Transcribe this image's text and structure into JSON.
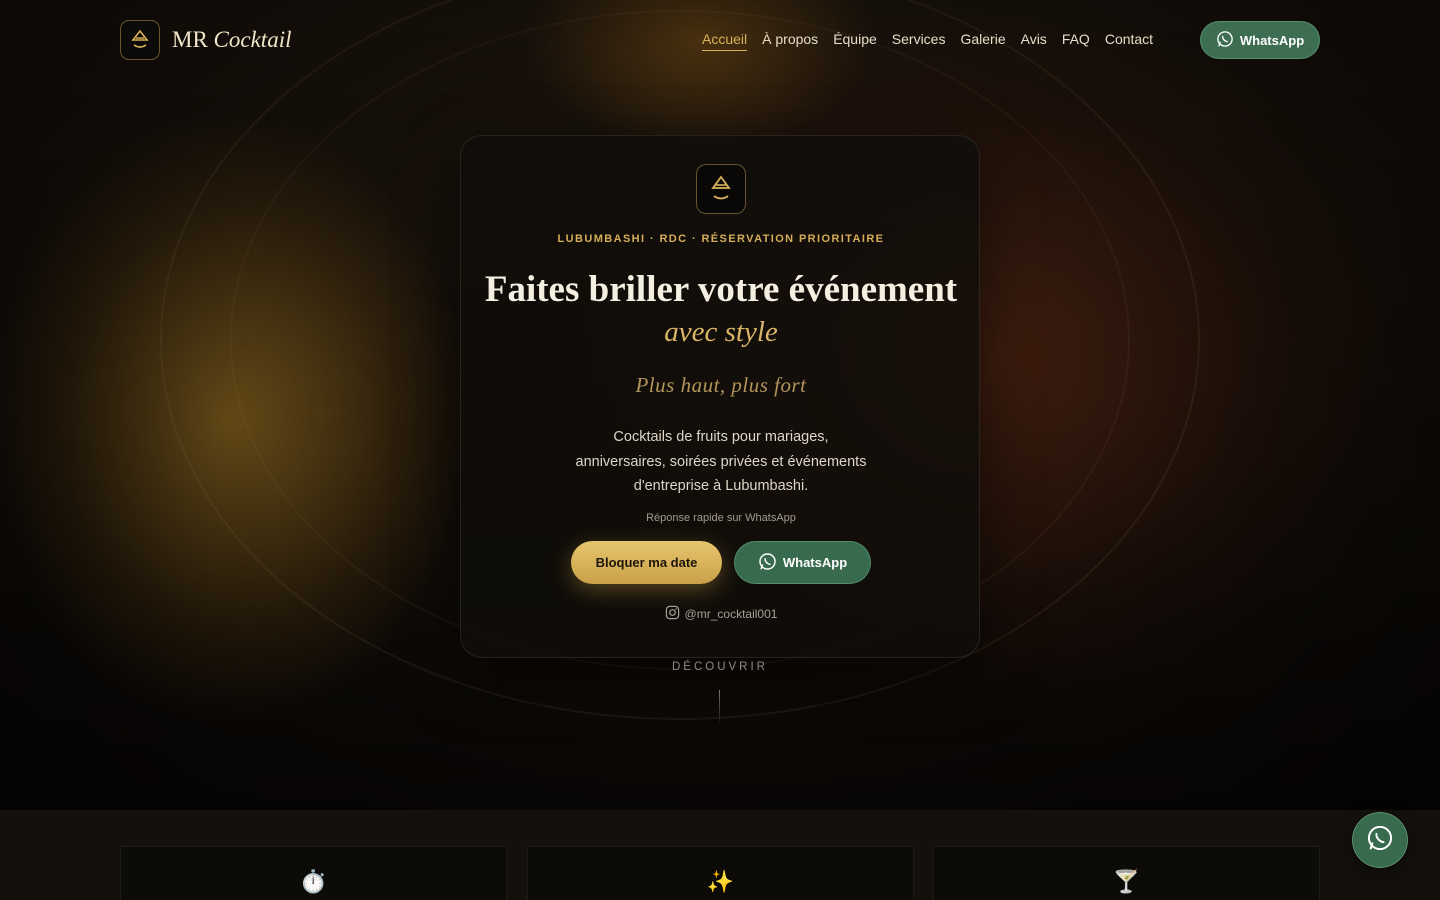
{
  "brand": {
    "name_prefix": "MR",
    "name_italic": "Cocktail"
  },
  "nav": {
    "items": [
      {
        "label": "Accueil",
        "active": true
      },
      {
        "label": "À propos",
        "active": false
      },
      {
        "label": "Équipe",
        "active": false
      },
      {
        "label": "Services",
        "active": false
      },
      {
        "label": "Galerie",
        "active": false
      },
      {
        "label": "Avis",
        "active": false
      },
      {
        "label": "FAQ",
        "active": false
      },
      {
        "label": "Contact",
        "active": false
      }
    ],
    "whatsapp_label": "WhatsApp"
  },
  "hero": {
    "eyebrow": "LUBUMBASHI · RDC · RÉSERVATION PRIORITAIRE",
    "headline": "Faites briller votre événement",
    "headline_accent": "avec style",
    "tagline": "Plus haut, plus fort",
    "description": "Cocktails de fruits pour mariages, anniversaires, soirées privées et événements d'entreprise à Lubumbashi.",
    "quick_reply": "Réponse rapide sur WhatsApp",
    "primary_button": "Bloquer ma date",
    "whatsapp_button": "WhatsApp",
    "instagram_handle": "@mr_cocktail001",
    "discover": "DÉCOUVRIR"
  },
  "features": [
    {
      "icon": "stopwatch-icon",
      "glyph": "⏱️"
    },
    {
      "icon": "sparkles-icon",
      "glyph": "✨"
    },
    {
      "icon": "cocktail-glass-icon",
      "glyph": "🍸"
    }
  ],
  "colors": {
    "accent_gold": "#d8b25a",
    "whatsapp_green": "#386a4e",
    "background": "#0b0907"
  }
}
